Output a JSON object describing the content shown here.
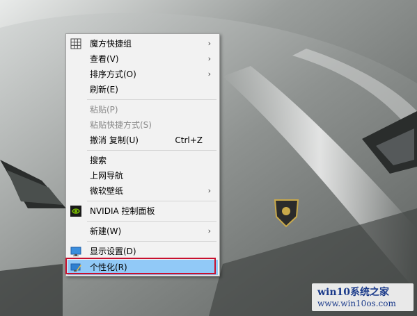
{
  "menu": {
    "items": [
      {
        "label": "魔方快捷组",
        "submenu": true,
        "icon": "grid-icon"
      },
      {
        "label": "查看(V)",
        "submenu": true
      },
      {
        "label": "排序方式(O)",
        "submenu": true
      },
      {
        "label": "刷新(E)"
      },
      {
        "label": "粘贴(P)",
        "disabled": true
      },
      {
        "label": "粘贴快捷方式(S)",
        "disabled": true
      },
      {
        "label": "撤消 复制(U)",
        "shortcut": "Ctrl+Z"
      },
      {
        "label": "搜索"
      },
      {
        "label": "上网导航"
      },
      {
        "label": "微软壁纸",
        "submenu": true
      },
      {
        "label": "NVIDIA 控制面板",
        "icon": "nvidia-icon"
      },
      {
        "label": "新建(W)",
        "submenu": true
      },
      {
        "label": "显示设置(D)",
        "icon": "display-icon"
      },
      {
        "label": "个性化(R)",
        "icon": "personalize-icon",
        "highlighted": true
      }
    ],
    "arrow": "›"
  },
  "watermark": {
    "title": "win10系统之家",
    "url": "www.win10os.com"
  },
  "colors": {
    "highlight": "#91c9f7",
    "annotation_box": "#c8102e"
  }
}
